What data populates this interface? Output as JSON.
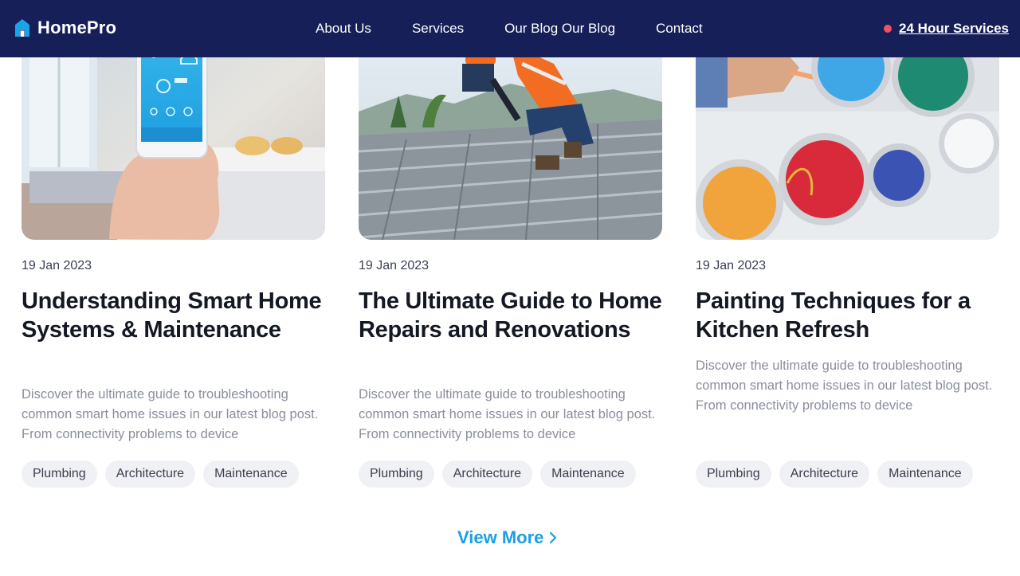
{
  "brand": {
    "name": "HomePro",
    "icon": "house-logo-icon",
    "accent": "#1aa3e8"
  },
  "nav": {
    "links": [
      {
        "label": "About Us"
      },
      {
        "label": "Services"
      },
      {
        "label": "Our Blog Our Blog"
      },
      {
        "label": "Contact"
      }
    ],
    "hours_label": "24 Hour Services",
    "hours_dot_color": "#f1525b",
    "background": "#161f57"
  },
  "posts": [
    {
      "image": "smartphone-smart-home-app-photo",
      "date": "19 Jan 2023",
      "title": "Understanding Smart Home Systems & Maintenance",
      "excerpt": "Discover the ultimate guide to troubleshooting common smart home issues in our latest blog post. From connectivity problems to device",
      "tags": [
        "Plumbing",
        "Architecture",
        "Maintenance"
      ]
    },
    {
      "image": "roof-workers-photo",
      "date": "19 Jan 2023",
      "title": "The Ultimate Guide to Home Repairs and Renovations",
      "excerpt": "Discover the ultimate guide to troubleshooting common smart home issues in our latest blog post. From connectivity problems to device",
      "tags": [
        "Plumbing",
        "Architecture",
        "Maintenance"
      ]
    },
    {
      "image": "paint-cans-photo",
      "date": "19 Jan 2023",
      "title": "Painting Techniques for a Kitchen Refresh",
      "excerpt": "Discover the ultimate guide to troubleshooting common smart home issues in our latest blog post. From connectivity problems to device",
      "tags": [
        "Plumbing",
        "Architecture",
        "Maintenance"
      ]
    }
  ],
  "view_more": {
    "label": "View More",
    "icon": "chevron-right-icon",
    "color": "#18a0e6"
  }
}
